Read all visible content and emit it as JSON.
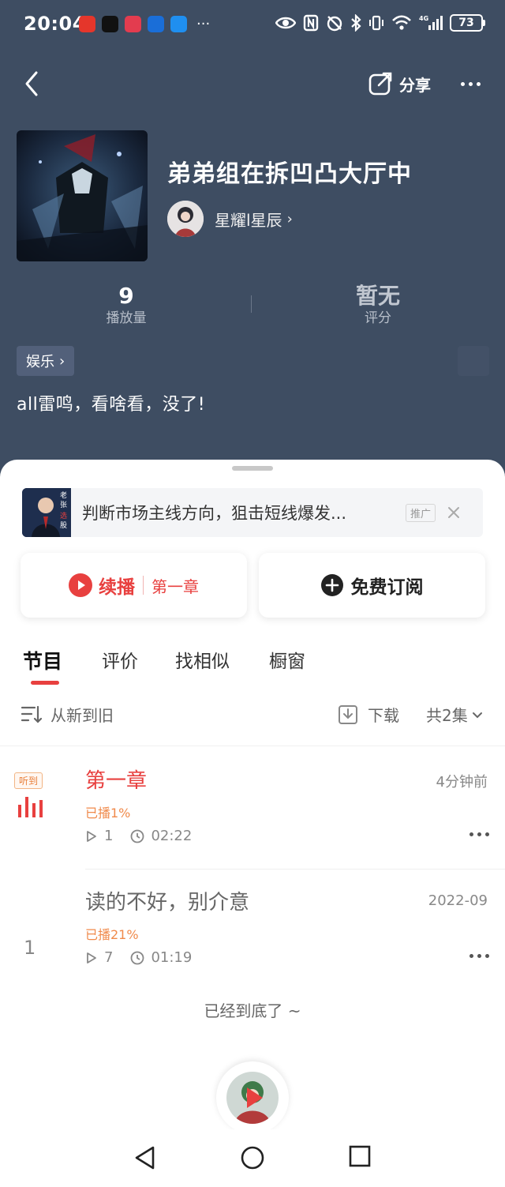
{
  "status_bar": {
    "time": "20:04",
    "more": "···",
    "battery": "73",
    "network": "4G"
  },
  "header": {
    "share_label": "分享",
    "back_icon": "chevron-left-icon",
    "more_icon": "more-dots-icon"
  },
  "album": {
    "title": "弟弟组在拆凹凸大厅中",
    "author": "星耀l星辰",
    "author_arrow": "›",
    "stats": [
      {
        "value": "9",
        "label": "播放量"
      },
      {
        "value": "暂无",
        "label": "评分"
      }
    ],
    "tag": "娱乐",
    "tag_arrow": "›",
    "description": "all雷鸣，看啥看，没了!"
  },
  "ad": {
    "text": "判断市场主线方向，狙击短线爆发...",
    "badge": "推广",
    "thumb_text": [
      "老",
      "张",
      "选",
      "股"
    ]
  },
  "actions": {
    "resume_label": "续播",
    "resume_chapter": "第一章",
    "subscribe_label": "免费订阅"
  },
  "tabs": [
    {
      "label": "节目",
      "active": true
    },
    {
      "label": "评价",
      "active": false
    },
    {
      "label": "找相似",
      "active": false
    },
    {
      "label": "橱窗",
      "active": false
    }
  ],
  "toolbar": {
    "sort_label": "从新到旧",
    "download_label": "下载",
    "count_label": "共2集"
  },
  "episodes": [
    {
      "badge": "听到",
      "title": "第一章",
      "date": "4分钟前",
      "progress": "已播1%",
      "plays": "1",
      "duration": "02:22"
    },
    {
      "number": "1",
      "title": "读的不好，别介意",
      "date": "2022-09",
      "progress": "已播21%",
      "plays": "7",
      "duration": "01:19"
    }
  ],
  "end_text": "已经到底了 ~",
  "colors": {
    "hero_bg": "#3e4d62",
    "accent_red": "#e8403f",
    "progress_orange": "#f08a4b"
  }
}
